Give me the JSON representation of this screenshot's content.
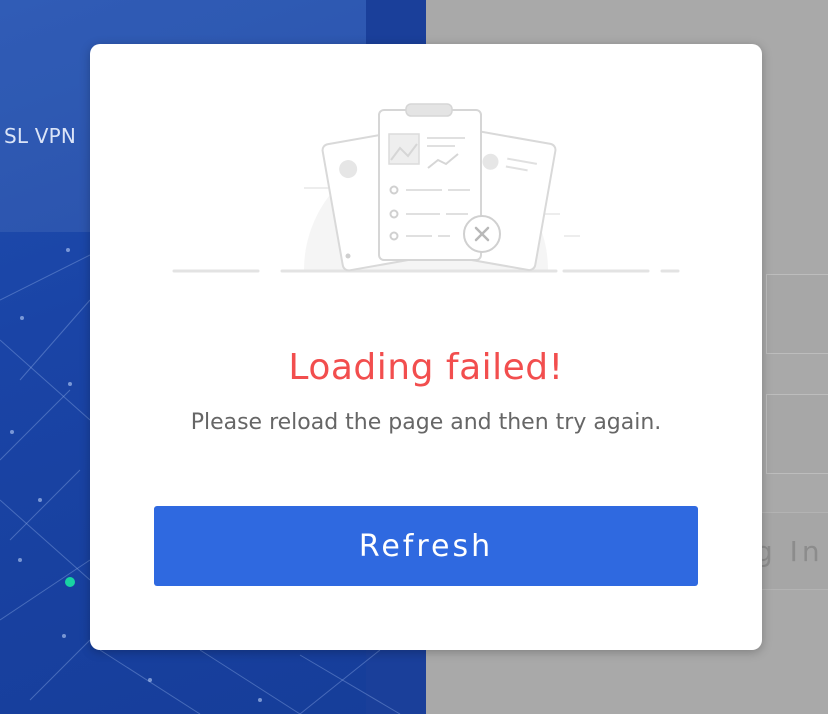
{
  "background": {
    "left_panel_text": "SL VPN",
    "login_button_partial": "g In"
  },
  "dialog": {
    "illustration_icon": "document-load-error-illustration",
    "title": "Loading failed!",
    "message": "Please reload the page and then try again.",
    "refresh_label": "Refresh"
  },
  "colors": {
    "accent": "#2f69e0",
    "error": "#f24e4e",
    "panel_blue": "#1a44a6",
    "overlay_grey": "#a9a9a9"
  }
}
